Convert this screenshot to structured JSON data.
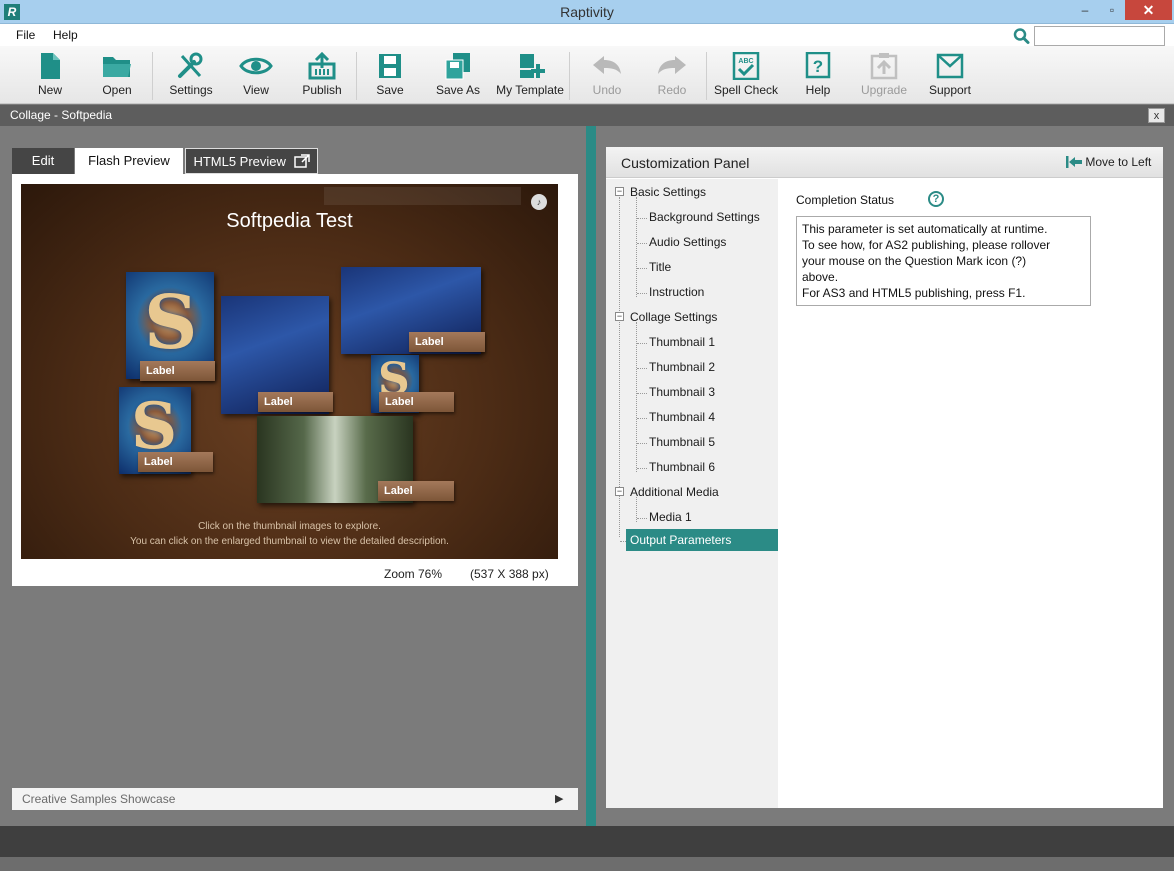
{
  "window": {
    "title": "Raptivity",
    "app_icon": "R",
    "min": "–",
    "max": "▫",
    "close": "✕"
  },
  "menu": {
    "items": [
      "File",
      "Help"
    ],
    "search_value": ""
  },
  "toolbar": {
    "new": "New",
    "open": "Open",
    "settings": "Settings",
    "view": "View",
    "publish": "Publish",
    "save": "Save",
    "save_as": "Save As",
    "my_template": "My Template",
    "undo": "Undo",
    "redo": "Redo",
    "spell_check": "Spell Check",
    "help": "Help",
    "upgrade": "Upgrade",
    "support": "Support"
  },
  "document": {
    "title": "Collage - Softpedia",
    "close": "x"
  },
  "tabs": {
    "edit": "Edit",
    "flash": "Flash Preview",
    "html5": "HTML5 Preview"
  },
  "preview": {
    "title": "Softpedia Test",
    "labels": [
      "Label",
      "Label",
      "Label",
      "Label",
      "Label",
      "Label"
    ],
    "instruction_1": "Click on the thumbnail images to explore.",
    "instruction_2": "You can click on the enlarged thumbnail to view the detailed description.",
    "zoom": "Zoom  76%",
    "dimensions": "(537 X 388 px)"
  },
  "showcase": {
    "label": "Creative Samples Showcase"
  },
  "panel": {
    "title": "Customization Panel",
    "move": "Move to Left"
  },
  "tree": {
    "basic": "Basic Settings",
    "background": "Background Settings",
    "audio": "Audio Settings",
    "title": "Title",
    "instruction": "Instruction",
    "collage": "Collage Settings",
    "thumb1": "Thumbnail  1",
    "thumb2": "Thumbnail  2",
    "thumb3": "Thumbnail  3",
    "thumb4": "Thumbnail  4",
    "thumb5": "Thumbnail  5",
    "thumb6": "Thumbnail  6",
    "additional": "Additional Media",
    "media1": "Media  1",
    "output": "Output Parameters"
  },
  "detail": {
    "label": "Completion Status",
    "help": "?",
    "line1": "This parameter is set automatically at runtime.",
    "line2": "To see how, for AS2 publishing, please rollover",
    "line3": "your mouse on the Question Mark icon (?)",
    "line4": "above.",
    "line5": "For AS3 and HTML5 publishing, press F1."
  },
  "colors": {
    "accent": "#2b8b86",
    "titlebar": "#a7cfee",
    "close": "#c7473d"
  }
}
